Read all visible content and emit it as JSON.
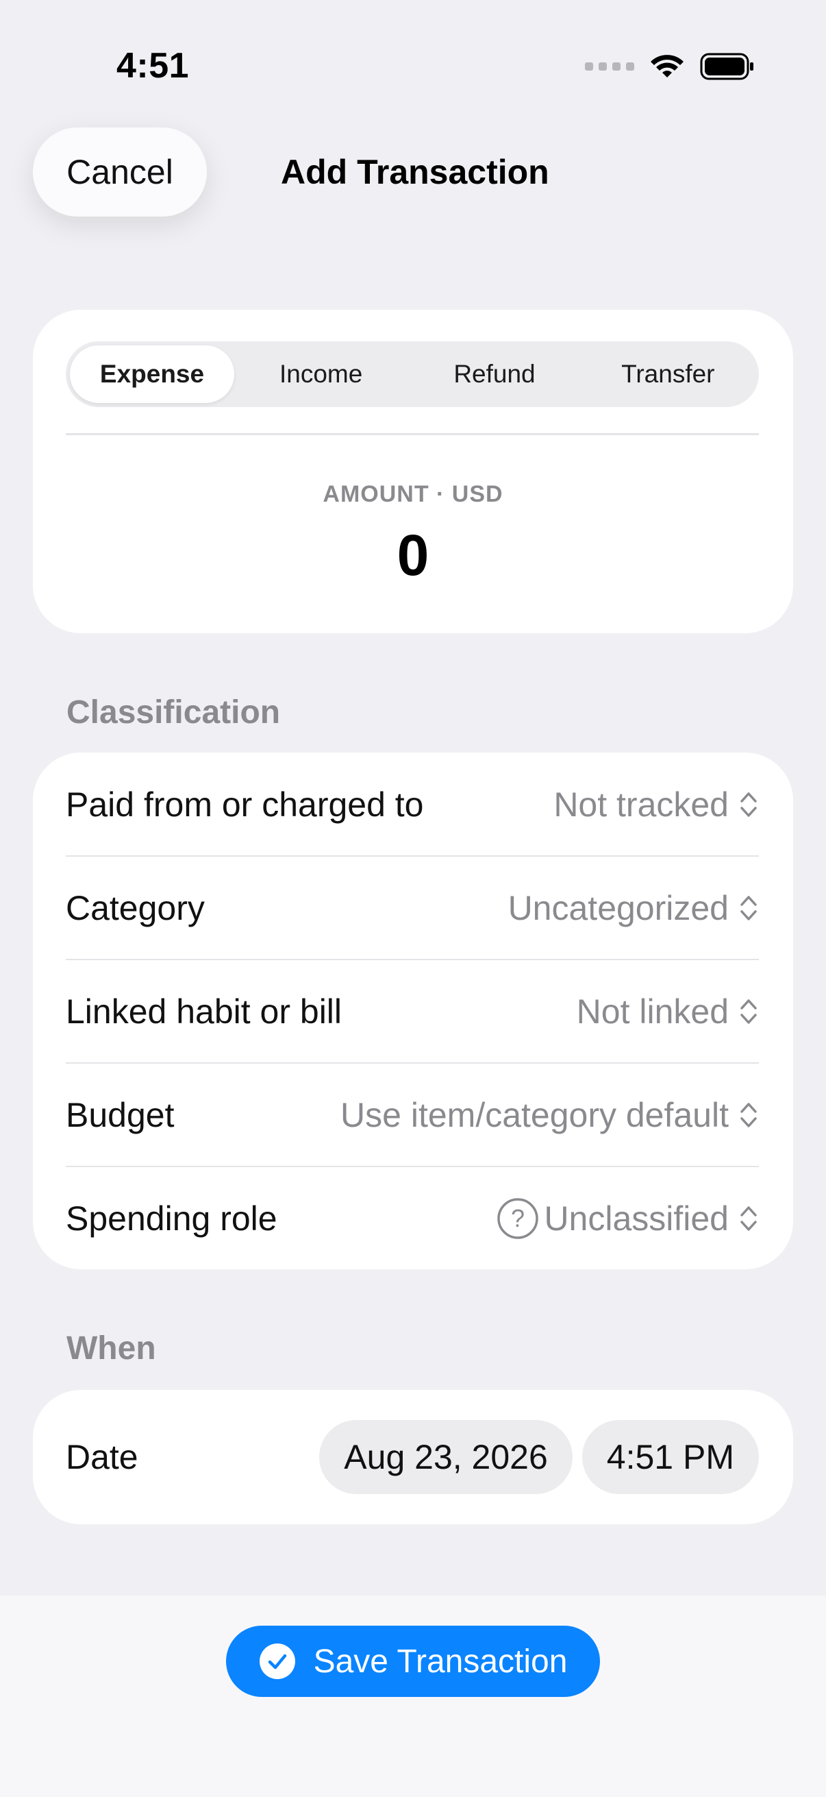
{
  "status_bar": {
    "time": "4:51"
  },
  "nav": {
    "cancel_label": "Cancel",
    "title": "Add Transaction"
  },
  "type_tabs": [
    {
      "label": "Expense",
      "selected": true
    },
    {
      "label": "Income",
      "selected": false
    },
    {
      "label": "Refund",
      "selected": false
    },
    {
      "label": "Transfer",
      "selected": false
    }
  ],
  "amount": {
    "label": "AMOUNT · USD",
    "value": "0"
  },
  "classification": {
    "section_label": "Classification",
    "rows": [
      {
        "label": "Paid from or charged to",
        "value": "Not tracked"
      },
      {
        "label": "Category",
        "value": "Uncategorized"
      },
      {
        "label": "Linked habit or bill",
        "value": "Not linked"
      },
      {
        "label": "Budget",
        "value": "Use item/category default"
      },
      {
        "label": "Spending role",
        "value": "Unclassified",
        "icon": "question-circle-icon"
      }
    ]
  },
  "when": {
    "section_label": "When",
    "date_label": "Date",
    "date_value": "Aug 23, 2026",
    "time_value": "4:51 PM"
  },
  "save_button": {
    "label": "Save Transaction",
    "icon": "checkmark-circle-icon"
  },
  "colors": {
    "accent": "#0a84ff",
    "background": "#f0f0f4",
    "secondary_text": "#8a8a8e"
  }
}
